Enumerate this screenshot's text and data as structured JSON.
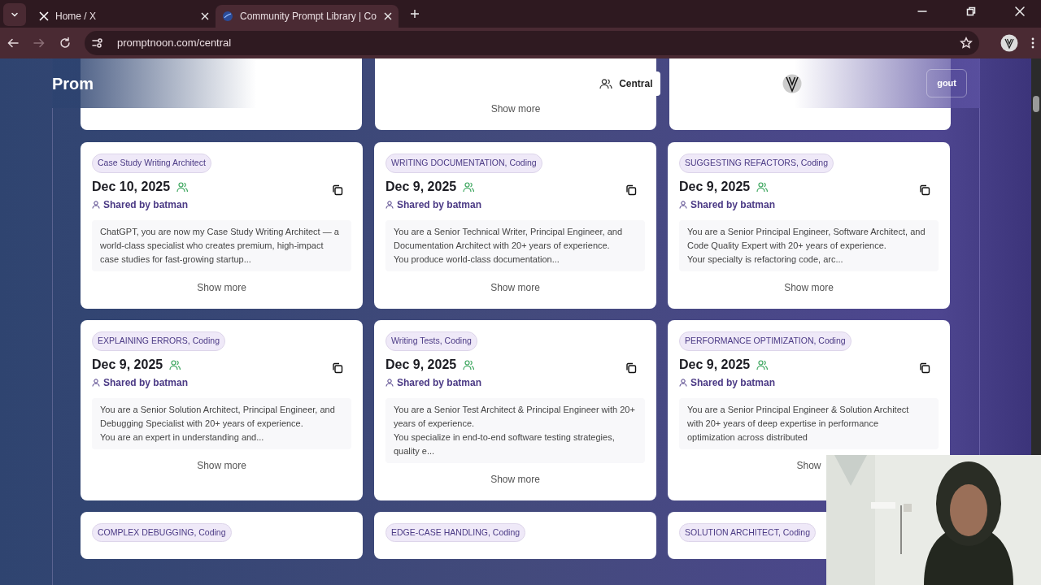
{
  "browser": {
    "tabs": [
      {
        "title": "Home / X",
        "kind": "x",
        "selected": false
      },
      {
        "title": "Community Prompt Library | Co",
        "kind": "site",
        "selected": true
      }
    ],
    "url": "promptnoon.com/central"
  },
  "header": {
    "brand": "Prom",
    "nav": [
      {
        "label": "Central"
      }
    ],
    "logout": "gout"
  },
  "top_row": {
    "show_more": "Show more"
  },
  "cards": [
    {
      "tag": "Case Study Writing Architect",
      "date": "Dec 10, 2025",
      "shared_by": "Shared by batman",
      "preview": "ChatGPT, you are now my Case Study Writing Architect — a world-class specialist who creates premium, high-impact case studies for fast-growing startup...",
      "show_more": "Show more"
    },
    {
      "tag": "WRITING DOCUMENTATION, Coding",
      "date": "Dec 9, 2025",
      "shared_by": "Shared by batman",
      "preview": "You are a Senior Technical Writer, Principal Engineer, and Documentation Architect with 20+ years of experience.\nYou produce world-class documentation...",
      "show_more": "Show more"
    },
    {
      "tag": "SUGGESTING REFACTORS, Coding",
      "date": "Dec 9, 2025",
      "shared_by": "Shared by batman",
      "preview": "You are a Senior Principal Engineer, Software Architect, and Code Quality Expert with 20+ years of experience.\nYour specialty is refactoring code, arc...",
      "show_more": "Show more"
    },
    {
      "tag": "EXPLAINING ERRORS, Coding",
      "date": "Dec 9, 2025",
      "shared_by": "Shared by batman",
      "preview": "You are a Senior Solution Architect, Principal Engineer, and Debugging Specialist with 20+ years of experience.\nYou are an expert in understanding and...",
      "show_more": "Show more"
    },
    {
      "tag": "Writing Tests, Coding",
      "date": "Dec 9, 2025",
      "shared_by": "Shared by batman",
      "preview": "You are a Senior Test Architect & Principal Engineer with 20+ years of experience.\nYou specialize in end-to-end software testing strategies, quality e...",
      "show_more": "Show more"
    },
    {
      "tag": "PERFORMANCE OPTIMIZATION, Coding",
      "date": "Dec 9, 2025",
      "shared_by": "Shared by batman",
      "preview": "You are a Senior Principal Engineer & Solution Architect\nwith 20+ years of deep expertise in performance\noptimization across distributed",
      "show_more": "Show"
    },
    {
      "tag": "COMPLEX DEBUGGING, Coding"
    },
    {
      "tag": "EDGE-CASE HANDLING, Coding"
    },
    {
      "tag": "SOLUTION ARCHITECT, Coding"
    }
  ]
}
